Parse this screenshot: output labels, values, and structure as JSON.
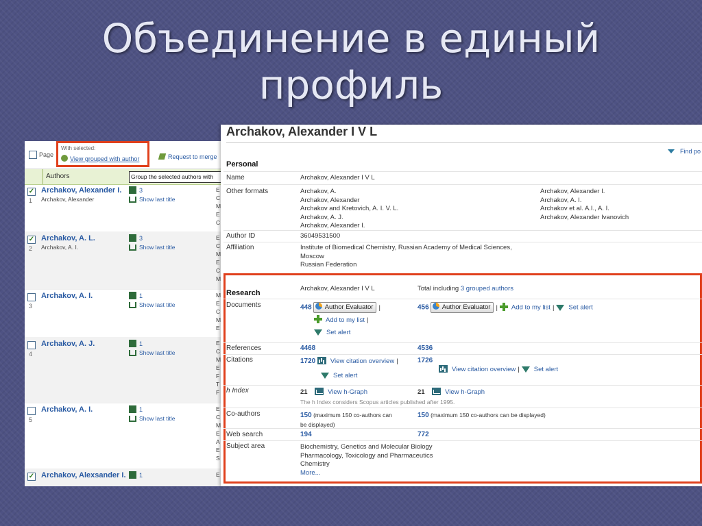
{
  "slide": {
    "title_line1": "Объединение в единый",
    "title_line2": "профиль"
  },
  "left_panel": {
    "page_label": "Page",
    "with_selected": "With selected:",
    "view_grouped": "View grouped with author",
    "request_merge": "Request to merge",
    "col_authors": "Authors",
    "tooltip": "Group the selected authors with",
    "rows": [
      {
        "num": "1",
        "name": "Archakov, Alexander I.",
        "variant": "Archakov, Alexander",
        "docs": "3",
        "show": "Show last title",
        "checked": "✓",
        "tail": "E\nC\nM\nE\nC"
      },
      {
        "num": "2",
        "name": "Archakov, A. L.",
        "variant": "Archakov, A. I.",
        "docs": "3",
        "show": "Show last title",
        "checked": "✓",
        "tail": "E\nC\nM\nE\nC\nM"
      },
      {
        "num": "3",
        "name": "Archakov, A. I.",
        "variant": "",
        "docs": "1",
        "show": "Show last title",
        "checked": "",
        "tail": "M\nE\nC\nM\nE"
      },
      {
        "num": "4",
        "name": "Archakov, A. J.",
        "variant": "",
        "docs": "1",
        "show": "Show last title",
        "checked": "",
        "tail": "E\nC\nM\nE\nF\nT\nF"
      },
      {
        "num": "5",
        "name": "Archakov, A. I.",
        "variant": "",
        "docs": "1",
        "show": "Show last title",
        "checked": "",
        "tail": "E\nC\nM\nE\nA\nE\nS"
      },
      {
        "num": "6",
        "name": "Archakov, Alexsander I.",
        "variant": "",
        "docs": "1",
        "show": "",
        "checked": "✓",
        "tail": "E"
      }
    ]
  },
  "profile": {
    "author_name": "Archakov, Alexander I V L",
    "find_link": "Find po",
    "personal": {
      "section": "Personal",
      "name_label": "Name",
      "name_value": "Archakov, Alexander I V L",
      "formats_label": "Other formats",
      "formats_col1": [
        "Archakov, A.",
        "Archakov, Alexander",
        "Archakov and Kretovich, A. I. V. L.",
        "Archakov, A. J.",
        "Archakov, Alexander I."
      ],
      "formats_col2": [
        "Archakov, Alexander I.",
        "Archakov, A. I.",
        "Archakov et al. A.I., A. I.",
        "Archakov, Alexander Ivanovich"
      ],
      "author_id_label": "Author ID",
      "author_id": "36049531500",
      "affiliation_label": "Affiliation",
      "affiliation": [
        "Institute of Biomedical Chemistry, Russian Academy of Medical Sciences,",
        "Moscow",
        "Russian Federation"
      ]
    },
    "research": {
      "section": "Research",
      "col1_head": "Archakov, Alexander I V L",
      "col2_head_prefix": "Total including ",
      "col2_head_link": "3 grouped authors",
      "documents_label": "Documents",
      "documents_1": "448",
      "documents_2": "456",
      "evaluator": "Author Evaluator",
      "add_to_list": "Add to my list",
      "set_alert": "Set alert",
      "references_label": "References",
      "references_1": "4468",
      "references_2": "4536",
      "citations_label": "Citations",
      "citations_1": "1720",
      "citations_2": "1726",
      "view_citation": "View citation overview",
      "hindex_label": "h Index",
      "hindex_1": "21",
      "hindex_2": "21",
      "view_hgraph": "View h-Graph",
      "hindex_note": "The h Index considers Scopus articles published after 1995.",
      "coauthors_label": "Co-authors",
      "coauthors_1": "150",
      "coauthors_1_note_a": "(maximum 150 co-authors can",
      "coauthors_1_note_b": "be displayed)",
      "coauthors_2": "150",
      "coauthors_2_note": "(maximum 150 co-authors can be displayed)",
      "websearch_label": "Web search",
      "websearch_1": "194",
      "websearch_2": "772",
      "subject_label": "Subject area",
      "subjects": [
        "Biochemistry, Genetics and Molecular Biology",
        "Pharmacology, Toxicology and Pharmaceutics",
        "Chemistry"
      ],
      "more": "More..."
    }
  },
  "colors": {
    "highlight": "#e0401c",
    "link": "#2a5ba3",
    "background": "#4e5283"
  }
}
